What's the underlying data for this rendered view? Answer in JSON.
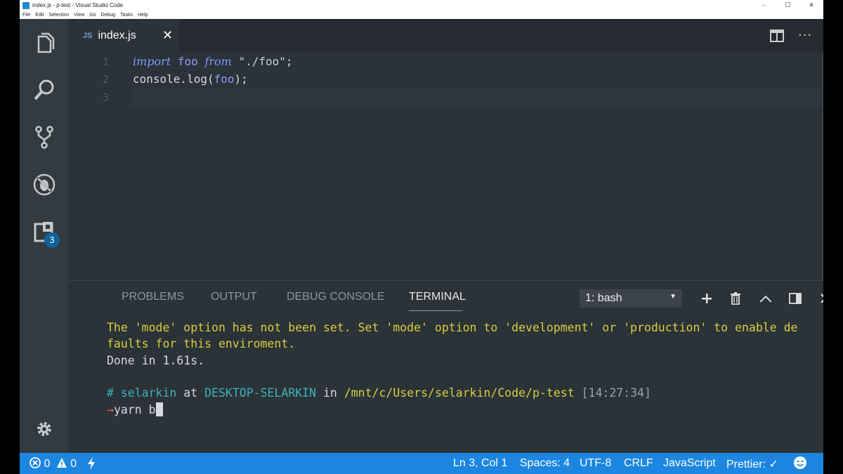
{
  "window": {
    "title": "index.js - p-test - Visual Studio Code",
    "controls": [
      "–",
      "☐",
      "✕"
    ]
  },
  "menu": [
    "File",
    "Edit",
    "Selection",
    "View",
    "Go",
    "Debug",
    "Tasks",
    "Help"
  ],
  "activity": {
    "extensions_badge": "3"
  },
  "editor": {
    "tab": {
      "icon_label": "JS",
      "name": "index.js",
      "close": "✕"
    },
    "more": "···",
    "lines": [
      {
        "num": "1",
        "tokens": [
          {
            "t": "import",
            "c": "kw"
          },
          {
            "t": " ",
            "c": "plain"
          },
          {
            "t": "foo",
            "c": "id"
          },
          {
            "t": " ",
            "c": "plain"
          },
          {
            "t": "from",
            "c": "kw"
          },
          {
            "t": " ",
            "c": "plain"
          },
          {
            "t": "\"./foo\"",
            "c": "str"
          },
          {
            "t": ";",
            "c": "plain"
          }
        ]
      },
      {
        "num": "2",
        "tokens": [
          {
            "t": "console.log(",
            "c": "plain"
          },
          {
            "t": "foo",
            "c": "id"
          },
          {
            "t": ");",
            "c": "plain"
          }
        ]
      },
      {
        "num": "3",
        "tokens": []
      }
    ]
  },
  "panel": {
    "tabs": [
      "PROBLEMS",
      "OUTPUT",
      "DEBUG CONSOLE",
      "TERMINAL"
    ],
    "active_tab": "TERMINAL",
    "terminal_select": "1: bash",
    "terminal": {
      "warn_line1": "The 'mode' option has not been set. Set 'mode' option to 'development' or 'production' to enable de",
      "warn_line2": "faults for this enviroment.",
      "done": "Done in 1.61s.",
      "prompt_hash": "#",
      "user": "selarkin",
      "at": "at",
      "host": "DESKTOP-SELARKIN",
      "in": "in",
      "path": "/mnt/c/Users/selarkin/Code/p-test",
      "time": "[14:27:34]",
      "arrow": "→",
      "command": "yarn b"
    }
  },
  "status": {
    "errors": "0",
    "warnings": "0",
    "position": "Ln 3, Col 1",
    "spaces": "Spaces: 4",
    "encoding": "UTF-8",
    "eol": "CRLF",
    "language": "JavaScript",
    "prettier": "Prettier: ✓"
  },
  "colors": {
    "activity_bar": "#333b41",
    "editor_bg": "#2b3238",
    "status_bar": "#1c86e0",
    "badge": "#0e639c",
    "terminal_warning": "#d7cf3e",
    "terminal_cyan": "#3cb3b5"
  }
}
